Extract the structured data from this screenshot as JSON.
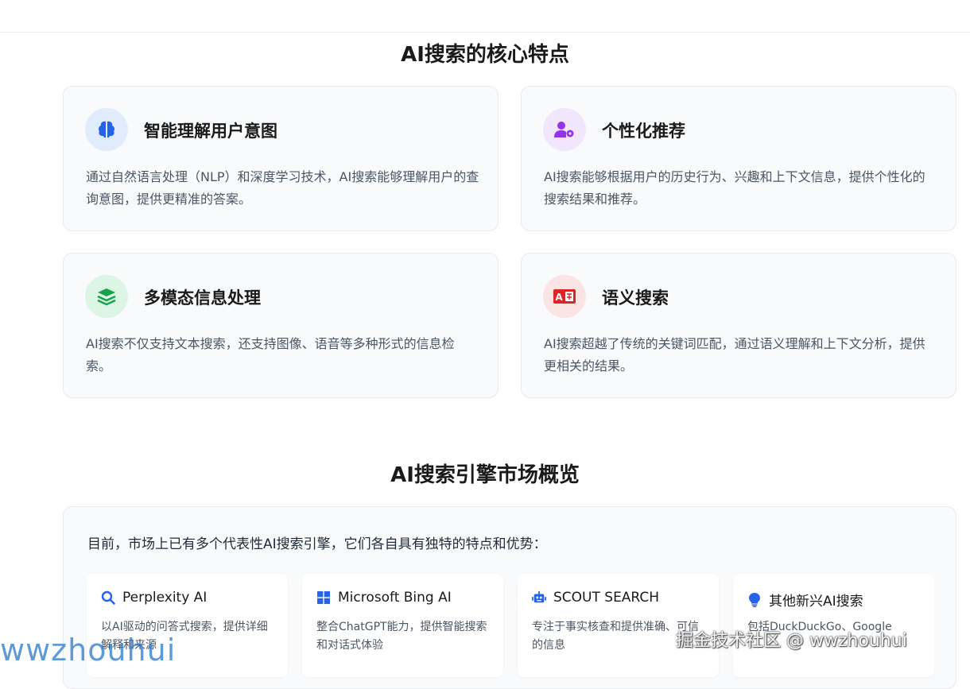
{
  "features_section": {
    "title": "AI搜索的核心特点",
    "cards": [
      {
        "icon": "brain-icon",
        "icon_bg": "#e0ecfc",
        "icon_color": "#2563eb",
        "title": "智能理解用户意图",
        "desc": "通过自然语言处理（NLP）和深度学习技术，AI搜索能够理解用户的查询意图，提供更精准的答案。"
      },
      {
        "icon": "user-gear-icon",
        "icon_bg": "#f1e6fb",
        "icon_color": "#9333ea",
        "title": "个性化推荐",
        "desc": "AI搜索能够根据用户的历史行为、兴趣和上下文信息，提供个性化的搜索结果和推荐。"
      },
      {
        "icon": "layers-icon",
        "icon_bg": "#dcf5e4",
        "icon_color": "#16a34a",
        "title": "多模态信息处理",
        "desc": "AI搜索不仅支持文本搜索，还支持图像、语音等多种形式的信息检索。"
      },
      {
        "icon": "translate-icon",
        "icon_bg": "#fbe4e4",
        "icon_color": "#dc2626",
        "title": "语义搜索",
        "desc": "AI搜索超越了传统的关键词匹配，通过语义理解和上下文分析，提供更相关的结果。"
      }
    ]
  },
  "market_section": {
    "title": "AI搜索引擎市场概览",
    "intro": "目前，市场上已有多个代表性AI搜索引擎，它们各自具有独特的特点和优势：",
    "engines": [
      {
        "icon": "search-icon",
        "name": "Perplexity AI",
        "desc": "以AI驱动的问答式搜索，提供详细解释和来源"
      },
      {
        "icon": "windows-icon",
        "name": "Microsoft Bing AI",
        "desc": "整合ChatGPT能力，提供智能搜索和对话式体验"
      },
      {
        "icon": "robot-icon",
        "name": "SCOUT SEARCH",
        "desc": "专注于事实核查和提供准确、可信的信息"
      },
      {
        "icon": "lightbulb-icon",
        "name": "其他新兴AI搜索",
        "desc": "包括DuckDuckGo、Google"
      }
    ]
  },
  "watermarks": {
    "left": "wwzhouhui",
    "right": "掘金技术社区 @ wwzhouhui"
  }
}
